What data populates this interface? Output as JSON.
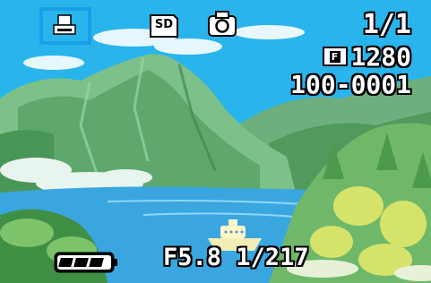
{
  "camera_display": {
    "top_icons": {
      "print_icon": "print-order-icon",
      "sd_card_label": "SD",
      "mode_icon": "camera-icon"
    },
    "frame_counter": "1/1",
    "quality_icon_label": "F",
    "image_size": "1280",
    "file_number": "100-0001",
    "battery_icon": "battery-full-icon",
    "aperture": "F5.8",
    "shutter_speed": "1/217",
    "colors": {
      "selection_highlight": "#1a9ee8",
      "text": "#ffffff",
      "sky": "#29b6ee",
      "lake": "#3aa6e0"
    }
  }
}
